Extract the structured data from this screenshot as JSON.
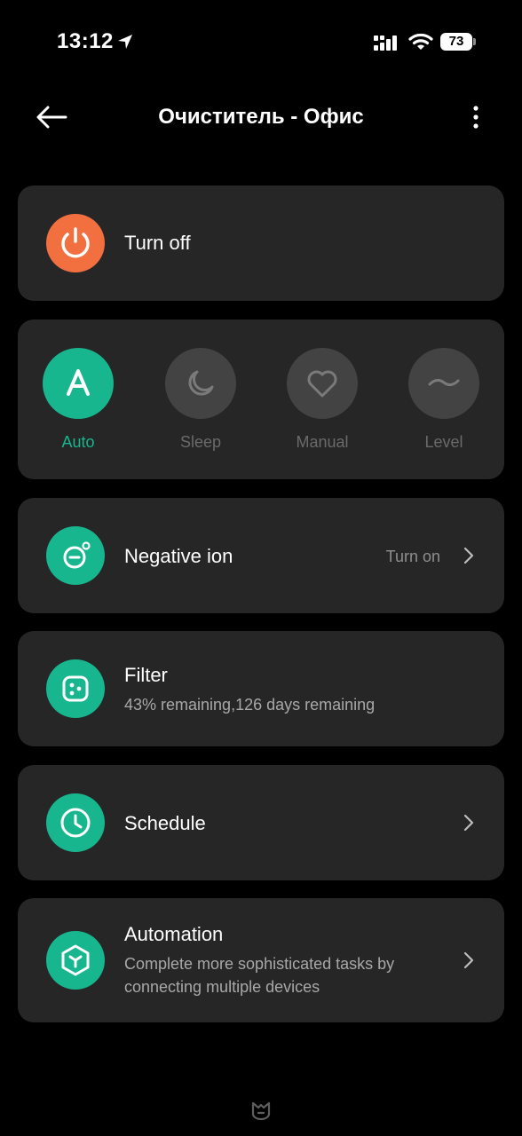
{
  "status_bar": {
    "time": "13:12",
    "battery": "73"
  },
  "header": {
    "title": "Очиститель - Офис"
  },
  "power": {
    "label": "Turn off",
    "color": "#f26f3f"
  },
  "modes": [
    {
      "label": "Auto",
      "icon": "A",
      "active": true
    },
    {
      "label": "Sleep",
      "active": false
    },
    {
      "label": "Manual",
      "active": false
    },
    {
      "label": "Level",
      "active": false
    }
  ],
  "negative_ion": {
    "title": "Negative ion",
    "status": "Turn on"
  },
  "filter": {
    "title": "Filter",
    "subtitle": "43% remaining,126 days remaining"
  },
  "schedule": {
    "title": "Schedule"
  },
  "automation": {
    "title": "Automation",
    "subtitle_line1": "Complete more sophisticated tasks by",
    "subtitle_line2": "connecting multiple devices"
  },
  "colors": {
    "accent": "#17b68e",
    "card": "#262626",
    "background": "#000000"
  }
}
